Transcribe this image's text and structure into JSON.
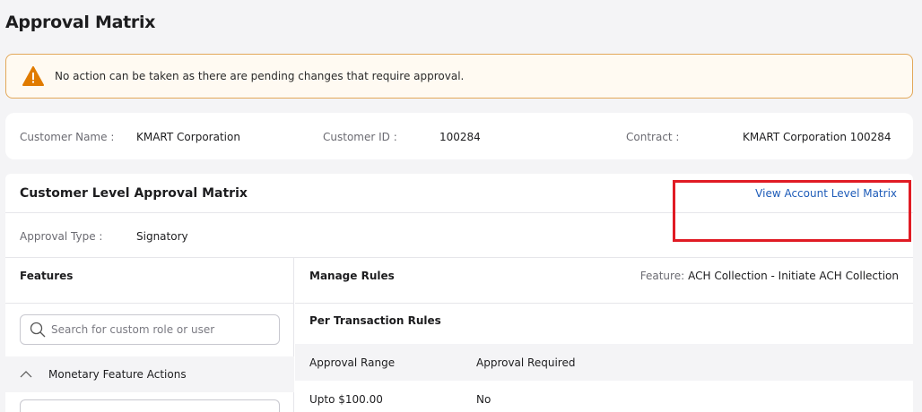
{
  "page": {
    "title": "Approval Matrix"
  },
  "alert": {
    "message": "No action can be taken as there are pending changes that require approval.",
    "icon": "warning-icon",
    "color": "#e2a85a"
  },
  "customer_info": {
    "name_label": "Customer Name :",
    "name_value": "KMART Corporation",
    "id_label": "Customer ID :",
    "id_value": "100284",
    "contract_label": "Contract :",
    "contract_value": "KMART Corporation 100284"
  },
  "matrix": {
    "title": "Customer Level Approval Matrix",
    "account_link": "View Account Level Matrix",
    "approval_type_label": "Approval Type :",
    "approval_type_value": "Signatory"
  },
  "features": {
    "heading": "Features",
    "search_placeholder": "Search for custom role or user",
    "group_label": "Monetary Feature Actions"
  },
  "rules": {
    "heading": "Manage Rules",
    "feature_label": "Feature:",
    "feature_value": "ACH Collection - Initiate ACH Collection",
    "section_title": "Per Transaction Rules",
    "columns": [
      "Approval Range",
      "Approval Required"
    ],
    "rows": [
      {
        "range": "Upto $100.00",
        "required": "No"
      }
    ]
  },
  "colors": {
    "accent_link": "#1d5bb8",
    "highlight": "#e01b24",
    "warning": "#e07b00"
  }
}
